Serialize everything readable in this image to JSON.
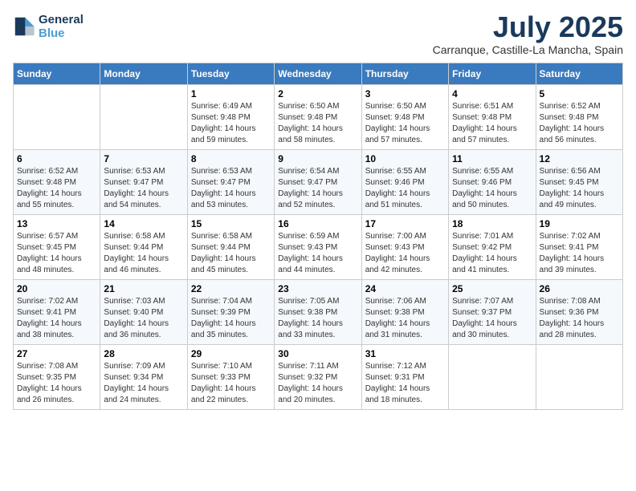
{
  "header": {
    "logo_line1": "General",
    "logo_line2": "Blue",
    "month": "July 2025",
    "location": "Carranque, Castille-La Mancha, Spain"
  },
  "weekdays": [
    "Sunday",
    "Monday",
    "Tuesday",
    "Wednesday",
    "Thursday",
    "Friday",
    "Saturday"
  ],
  "weeks": [
    [
      {
        "num": "",
        "info": ""
      },
      {
        "num": "",
        "info": ""
      },
      {
        "num": "1",
        "info": "Sunrise: 6:49 AM\nSunset: 9:48 PM\nDaylight: 14 hours and 59 minutes."
      },
      {
        "num": "2",
        "info": "Sunrise: 6:50 AM\nSunset: 9:48 PM\nDaylight: 14 hours and 58 minutes."
      },
      {
        "num": "3",
        "info": "Sunrise: 6:50 AM\nSunset: 9:48 PM\nDaylight: 14 hours and 57 minutes."
      },
      {
        "num": "4",
        "info": "Sunrise: 6:51 AM\nSunset: 9:48 PM\nDaylight: 14 hours and 57 minutes."
      },
      {
        "num": "5",
        "info": "Sunrise: 6:52 AM\nSunset: 9:48 PM\nDaylight: 14 hours and 56 minutes."
      }
    ],
    [
      {
        "num": "6",
        "info": "Sunrise: 6:52 AM\nSunset: 9:48 PM\nDaylight: 14 hours and 55 minutes."
      },
      {
        "num": "7",
        "info": "Sunrise: 6:53 AM\nSunset: 9:47 PM\nDaylight: 14 hours and 54 minutes."
      },
      {
        "num": "8",
        "info": "Sunrise: 6:53 AM\nSunset: 9:47 PM\nDaylight: 14 hours and 53 minutes."
      },
      {
        "num": "9",
        "info": "Sunrise: 6:54 AM\nSunset: 9:47 PM\nDaylight: 14 hours and 52 minutes."
      },
      {
        "num": "10",
        "info": "Sunrise: 6:55 AM\nSunset: 9:46 PM\nDaylight: 14 hours and 51 minutes."
      },
      {
        "num": "11",
        "info": "Sunrise: 6:55 AM\nSunset: 9:46 PM\nDaylight: 14 hours and 50 minutes."
      },
      {
        "num": "12",
        "info": "Sunrise: 6:56 AM\nSunset: 9:45 PM\nDaylight: 14 hours and 49 minutes."
      }
    ],
    [
      {
        "num": "13",
        "info": "Sunrise: 6:57 AM\nSunset: 9:45 PM\nDaylight: 14 hours and 48 minutes."
      },
      {
        "num": "14",
        "info": "Sunrise: 6:58 AM\nSunset: 9:44 PM\nDaylight: 14 hours and 46 minutes."
      },
      {
        "num": "15",
        "info": "Sunrise: 6:58 AM\nSunset: 9:44 PM\nDaylight: 14 hours and 45 minutes."
      },
      {
        "num": "16",
        "info": "Sunrise: 6:59 AM\nSunset: 9:43 PM\nDaylight: 14 hours and 44 minutes."
      },
      {
        "num": "17",
        "info": "Sunrise: 7:00 AM\nSunset: 9:43 PM\nDaylight: 14 hours and 42 minutes."
      },
      {
        "num": "18",
        "info": "Sunrise: 7:01 AM\nSunset: 9:42 PM\nDaylight: 14 hours and 41 minutes."
      },
      {
        "num": "19",
        "info": "Sunrise: 7:02 AM\nSunset: 9:41 PM\nDaylight: 14 hours and 39 minutes."
      }
    ],
    [
      {
        "num": "20",
        "info": "Sunrise: 7:02 AM\nSunset: 9:41 PM\nDaylight: 14 hours and 38 minutes."
      },
      {
        "num": "21",
        "info": "Sunrise: 7:03 AM\nSunset: 9:40 PM\nDaylight: 14 hours and 36 minutes."
      },
      {
        "num": "22",
        "info": "Sunrise: 7:04 AM\nSunset: 9:39 PM\nDaylight: 14 hours and 35 minutes."
      },
      {
        "num": "23",
        "info": "Sunrise: 7:05 AM\nSunset: 9:38 PM\nDaylight: 14 hours and 33 minutes."
      },
      {
        "num": "24",
        "info": "Sunrise: 7:06 AM\nSunset: 9:38 PM\nDaylight: 14 hours and 31 minutes."
      },
      {
        "num": "25",
        "info": "Sunrise: 7:07 AM\nSunset: 9:37 PM\nDaylight: 14 hours and 30 minutes."
      },
      {
        "num": "26",
        "info": "Sunrise: 7:08 AM\nSunset: 9:36 PM\nDaylight: 14 hours and 28 minutes."
      }
    ],
    [
      {
        "num": "27",
        "info": "Sunrise: 7:08 AM\nSunset: 9:35 PM\nDaylight: 14 hours and 26 minutes."
      },
      {
        "num": "28",
        "info": "Sunrise: 7:09 AM\nSunset: 9:34 PM\nDaylight: 14 hours and 24 minutes."
      },
      {
        "num": "29",
        "info": "Sunrise: 7:10 AM\nSunset: 9:33 PM\nDaylight: 14 hours and 22 minutes."
      },
      {
        "num": "30",
        "info": "Sunrise: 7:11 AM\nSunset: 9:32 PM\nDaylight: 14 hours and 20 minutes."
      },
      {
        "num": "31",
        "info": "Sunrise: 7:12 AM\nSunset: 9:31 PM\nDaylight: 14 hours and 18 minutes."
      },
      {
        "num": "",
        "info": ""
      },
      {
        "num": "",
        "info": ""
      }
    ]
  ]
}
